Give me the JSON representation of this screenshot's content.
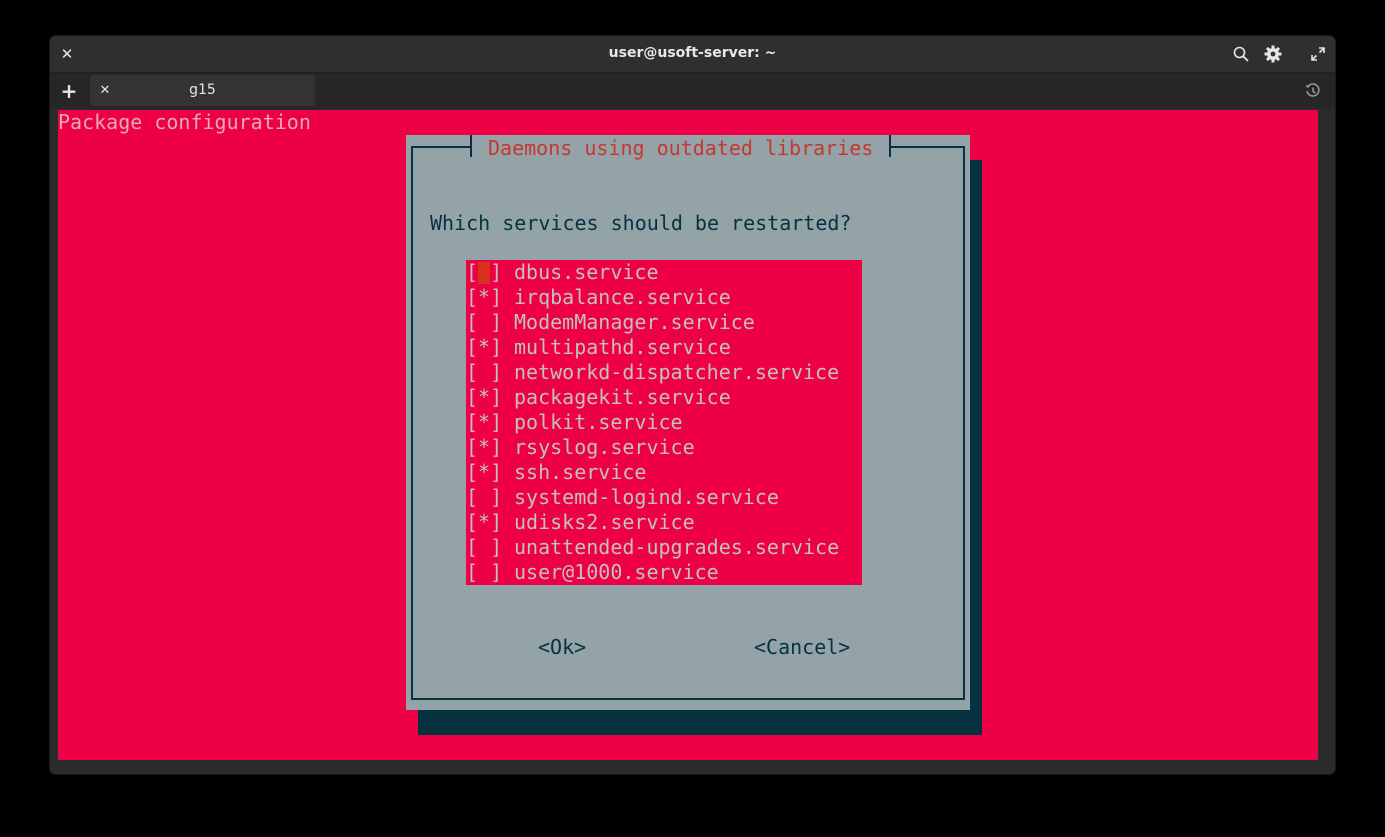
{
  "window": {
    "title": "user@usoft-server: ~",
    "close_glyph": "✕",
    "icons": [
      "search-icon",
      "gear-icon",
      "maximize-icon"
    ]
  },
  "tabbar": {
    "new_tab_glyph": "+",
    "tabs": [
      {
        "label": "g15",
        "close_glyph": "✕"
      }
    ],
    "history_icon": "history-icon"
  },
  "terminal": {
    "header_line": "Package configuration",
    "background": "#ee0047"
  },
  "dialog": {
    "title": "Daemons using outdated libraries",
    "question": "Which services should be restarted?",
    "items": [
      {
        "box": "[ ]",
        "label": "dbus.service"
      },
      {
        "box": "[*]",
        "label": "irqbalance.service"
      },
      {
        "box": "[ ]",
        "label": "ModemManager.service"
      },
      {
        "box": "[*]",
        "label": "multipathd.service"
      },
      {
        "box": "[ ]",
        "label": "networkd-dispatcher.service"
      },
      {
        "box": "[*]",
        "label": "packagekit.service"
      },
      {
        "box": "[*]",
        "label": "polkit.service"
      },
      {
        "box": "[*]",
        "label": "rsyslog.service"
      },
      {
        "box": "[*]",
        "label": "ssh.service"
      },
      {
        "box": "[ ]",
        "label": "systemd-logind.service"
      },
      {
        "box": "[*]",
        "label": "udisks2.service"
      },
      {
        "box": "[ ]",
        "label": "unattended-upgrades.service"
      },
      {
        "box": "[ ]",
        "label": "user@1000.service"
      }
    ],
    "ok_label": "<Ok>",
    "cancel_label": "<Cancel>",
    "colors": {
      "panel": "#94a3a7",
      "shadow": "#063240",
      "title": "#c6372f",
      "cursor": "#d6331c"
    }
  }
}
